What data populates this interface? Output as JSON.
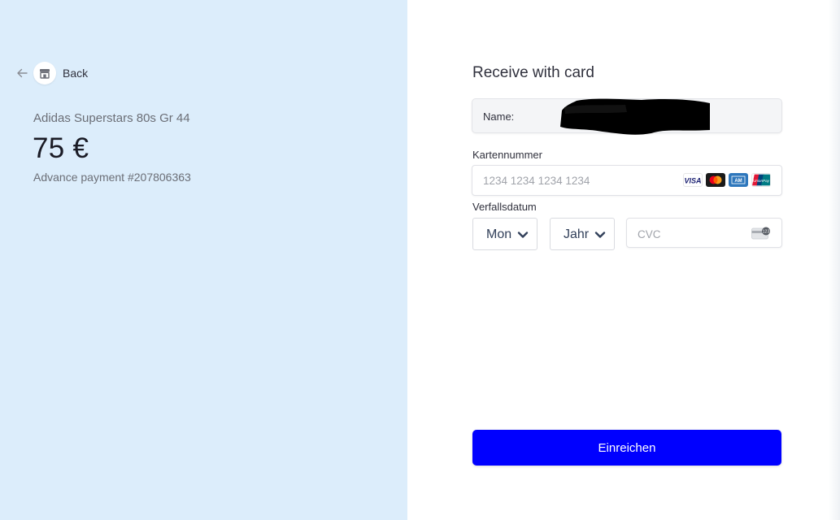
{
  "header": {
    "back_label": "Back",
    "back_icon": "arrow-left-icon",
    "store_icon": "store-icon"
  },
  "order": {
    "product_name": "Adidas Superstars 80s Gr 44",
    "price": "75 €",
    "payment_reference": "Advance payment #207806363"
  },
  "form": {
    "title": "Receive with card",
    "name_label": "Name:",
    "name_value_redacted": true,
    "card_number_label": "Kartennummer",
    "card_number_placeholder": "1234 1234 1234 1234",
    "card_brands": [
      "visa-icon",
      "mastercard-icon",
      "amex-icon",
      "unionpay-icon"
    ],
    "expiry_label": "Verfallsdatum",
    "month_value": "Mon",
    "year_value": "Jahr",
    "cvc_placeholder": "CVC",
    "submit_label": "Einreichen"
  },
  "colors": {
    "left_background": "#dcedfb",
    "accent_button": "#0000ff",
    "select_text": "#32405a"
  }
}
